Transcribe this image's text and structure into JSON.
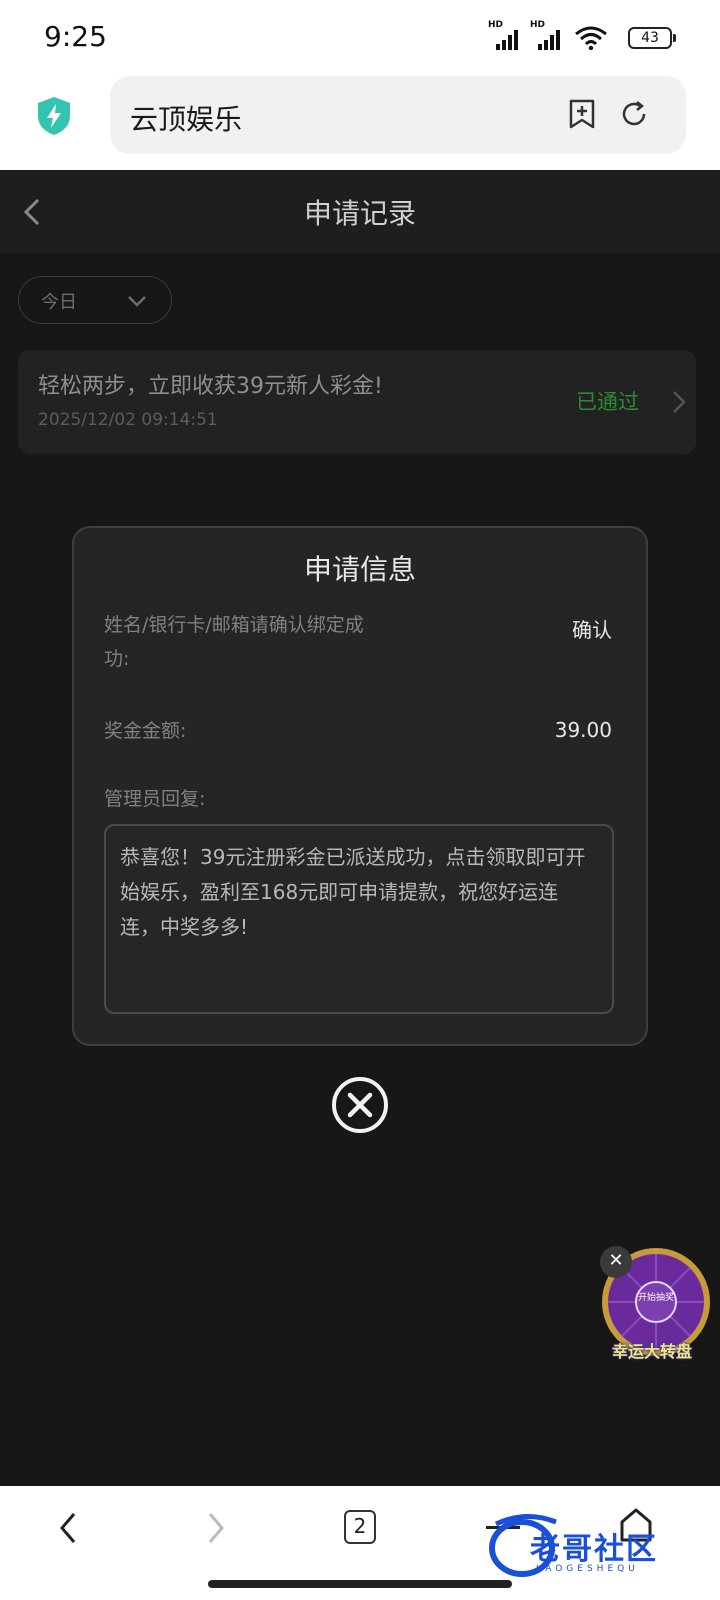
{
  "status_bar": {
    "time": "9:25",
    "battery": "43",
    "signal_label": "HD"
  },
  "browser": {
    "url_title": "云顶娱乐",
    "tab_count": "2"
  },
  "header": {
    "title": "申请记录"
  },
  "filter": {
    "label": "今日"
  },
  "record": {
    "title": "轻松两步，立即收获39元新人彩金!",
    "datetime": "2025/12/02 09:14:51",
    "status": "已通过",
    "status_color": "#2d8a2d"
  },
  "modal": {
    "title": "申请信息",
    "field1_label": "姓名/银行卡/邮箱请确认绑定成功:",
    "field1_value": "确认",
    "field2_label": "奖金金额:",
    "field2_value": "39.00",
    "reply_label": "管理员回复:",
    "reply_text": "恭喜您！39元注册彩金已派送成功，点击领取即可开始娱乐，盈利至168元即可申请提款，祝您好运连连，中奖多多!"
  },
  "floating": {
    "wheel_label": "幸运大转盘",
    "wheel_center": "开始抽奖"
  },
  "watermark": {
    "text": "老哥社区",
    "sub": "LAOGESHEQU"
  }
}
